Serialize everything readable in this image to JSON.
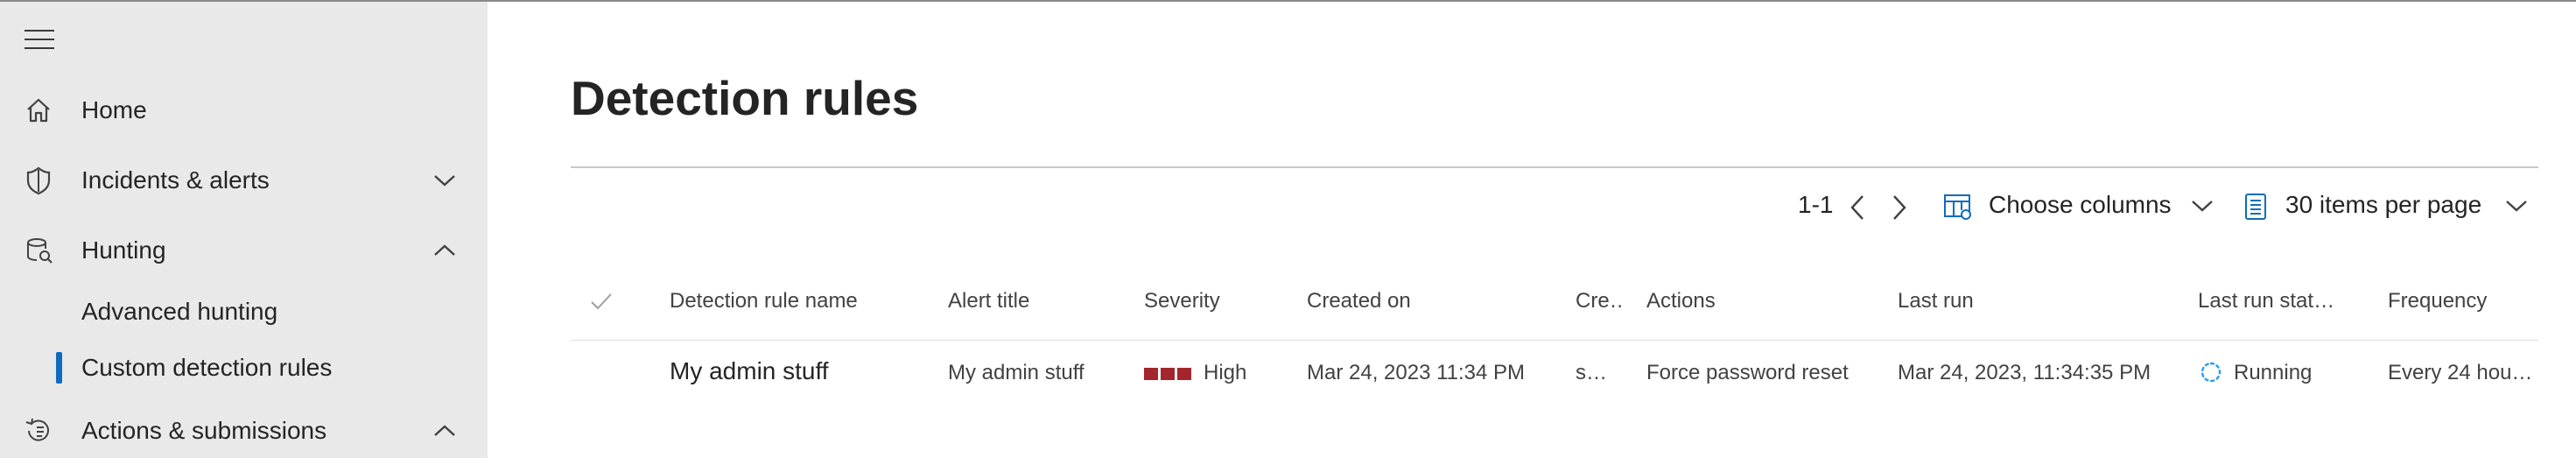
{
  "sidebar": {
    "items": [
      {
        "label": "Home",
        "icon": "home-icon"
      },
      {
        "label": "Incidents & alerts",
        "icon": "shield-icon",
        "expanded": false
      },
      {
        "label": "Hunting",
        "icon": "hunting-icon",
        "expanded": true
      },
      {
        "label": "Actions & submissions",
        "icon": "actions-icon",
        "expanded": true
      }
    ],
    "hunting_children": [
      {
        "label": "Advanced hunting",
        "active": false
      },
      {
        "label": "Custom detection rules",
        "active": true
      }
    ]
  },
  "main": {
    "title": "Detection rules",
    "pager": {
      "range": "1-1"
    },
    "choose_columns_label": "Choose columns",
    "items_per_page_label": "30 items per page"
  },
  "table": {
    "columns": [
      "Detection rule name",
      "Alert title",
      "Severity",
      "Created on",
      "Cre…",
      "Actions",
      "Last run",
      "Last run stat…",
      "Frequency"
    ],
    "rows": [
      {
        "name": "My admin stuff",
        "alert_title": "My admin stuff",
        "severity": "High",
        "created_on": "Mar 24, 2023 11:34 PM",
        "created_by": "s…",
        "actions": "Force password reset",
        "last_run": "Mar 24, 2023, 11:34:35 PM",
        "last_run_status": "Running",
        "frequency": "Every 24 hou…"
      }
    ]
  },
  "colors": {
    "sidebar_bg": "#e9e9e9",
    "accent": "#0f6cbd",
    "severity_high": "#a4262c",
    "running_spinner": "#2899f5"
  }
}
